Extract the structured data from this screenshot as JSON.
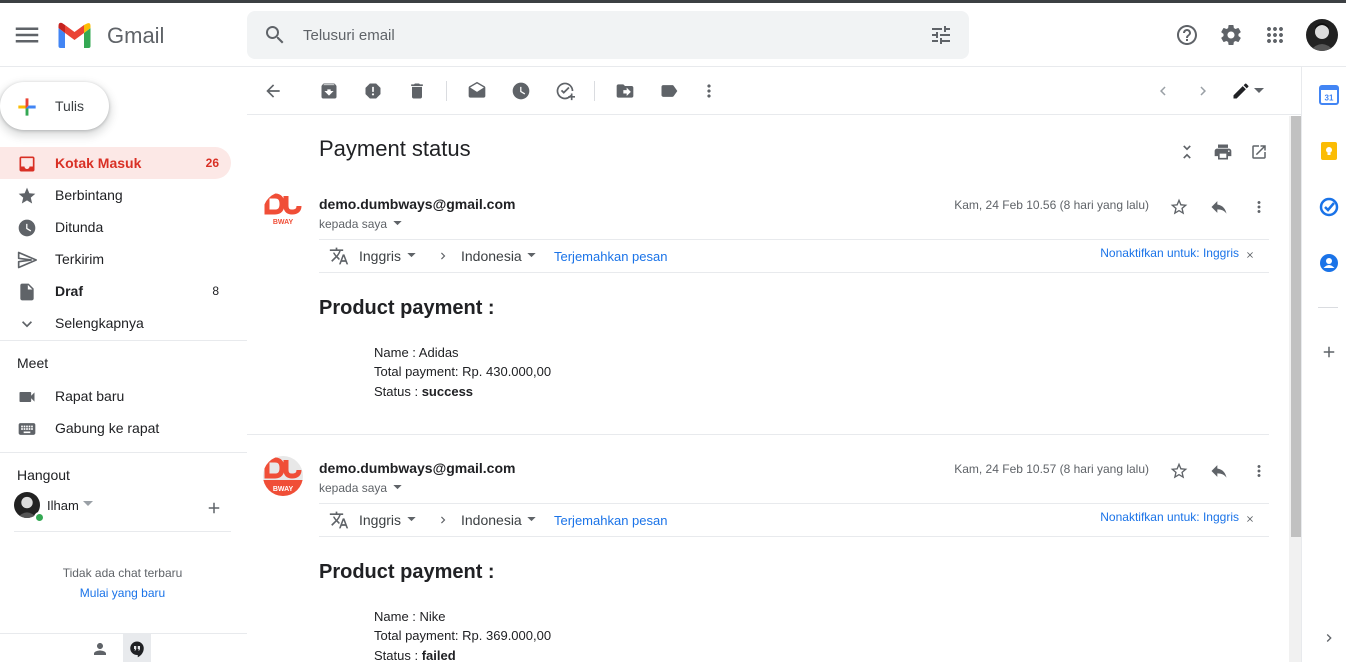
{
  "app": {
    "name": "Gmail"
  },
  "search": {
    "placeholder": "Telusuri email"
  },
  "compose": {
    "label": "Tulis"
  },
  "nav": [
    {
      "label": "Kotak Masuk",
      "count": "26",
      "icon": "inbox-icon",
      "active": true
    },
    {
      "label": "Berbintang",
      "count": "",
      "icon": "star-icon"
    },
    {
      "label": "Ditunda",
      "count": "",
      "icon": "clock-icon"
    },
    {
      "label": "Terkirim",
      "count": "",
      "icon": "send-icon"
    },
    {
      "label": "Draf",
      "count": "8",
      "icon": "draft-icon"
    },
    {
      "label": "Selengkapnya",
      "count": "",
      "icon": "chevron-down-icon"
    }
  ],
  "meet": {
    "title": "Meet",
    "items": [
      {
        "label": "Rapat baru",
        "icon": "videocam-icon"
      },
      {
        "label": "Gabung ke rapat",
        "icon": "keyboard-icon"
      }
    ]
  },
  "hangout": {
    "title": "Hangout",
    "user": "Ilham",
    "no_chat": "Tidak ada chat terbaru",
    "start_new": "Mulai yang baru"
  },
  "thread": {
    "subject": "Payment status",
    "messages": [
      {
        "from": "demo.dumbways@gmail.com",
        "to": "kepada saya",
        "date": "Kam, 24 Feb 10.56 (8 hari yang lalu)",
        "translate": {
          "from_lang": "Inggris",
          "to_lang": "Indonesia",
          "translate_label": "Terjemahkan pesan",
          "turn_off": "Nonaktifkan untuk: Inggris"
        },
        "body": {
          "title": "Product payment :",
          "name_label": "Name : ",
          "name": "Adidas",
          "total_label": "Total payment: ",
          "total": "Rp. 430.000,00",
          "status_label": "Status : ",
          "status": "success"
        }
      },
      {
        "from": "demo.dumbways@gmail.com",
        "to": "kepada saya",
        "date": "Kam, 24 Feb 10.57 (8 hari yang lalu)",
        "translate": {
          "from_lang": "Inggris",
          "to_lang": "Indonesia",
          "translate_label": "Terjemahkan pesan",
          "turn_off": "Nonaktifkan untuk: Inggris"
        },
        "body": {
          "title": "Product payment :",
          "name_label": "Name : ",
          "name": "Nike",
          "total_label": "Total payment: ",
          "total": "Rp. 369.000,00",
          "status_label": "Status : ",
          "status": "failed"
        }
      }
    ]
  },
  "sender_logo": {
    "text": "BWAY"
  },
  "calendar_day": "31",
  "colors": {
    "accent_red": "#d93025",
    "active_bg": "#fce8e6",
    "link_blue": "#1a73e8",
    "brand_orange": "#f04e37"
  }
}
